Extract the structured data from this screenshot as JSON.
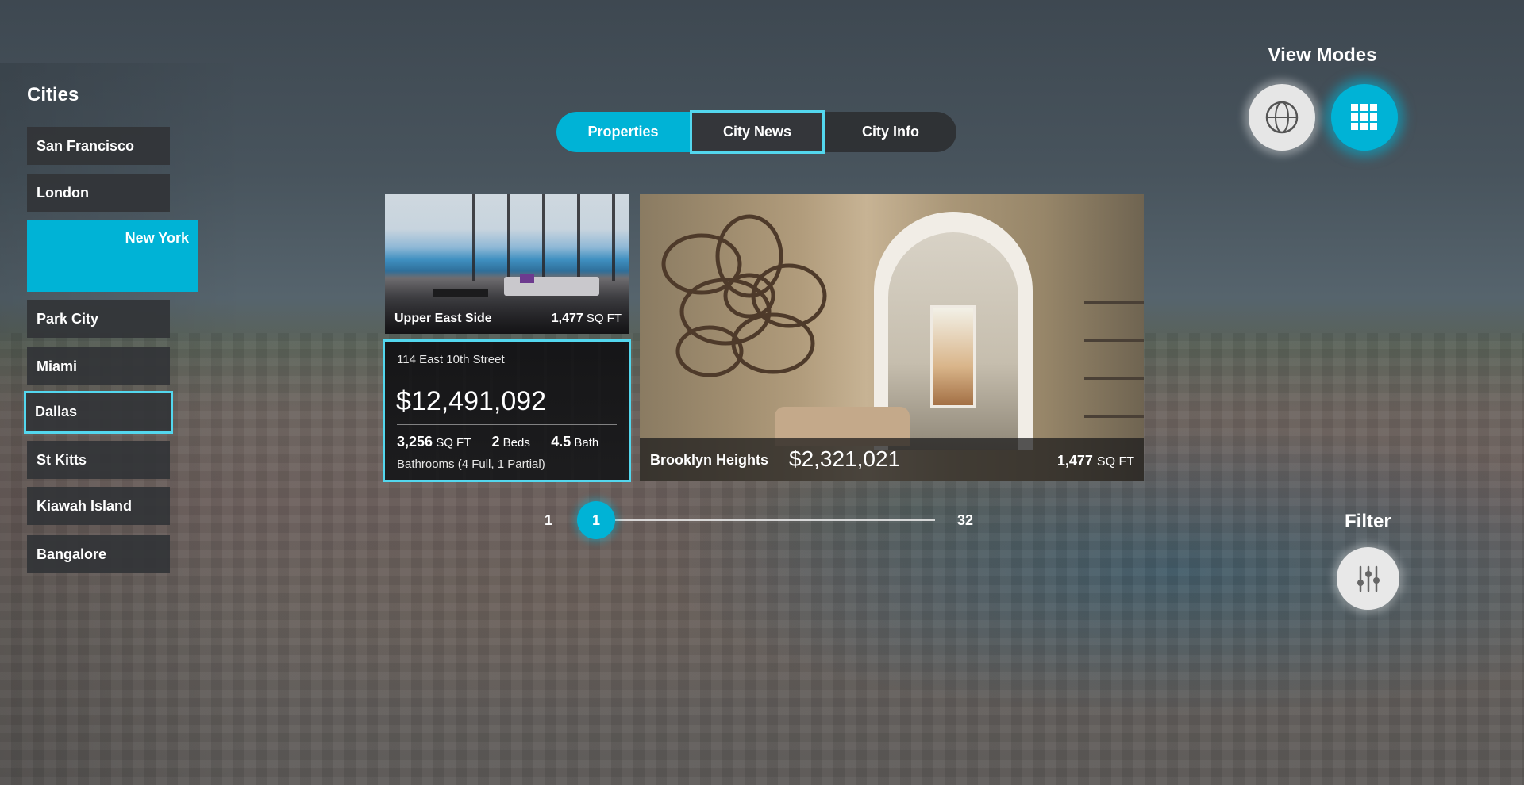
{
  "sidebar": {
    "title": "Cities",
    "items": [
      {
        "label": "San Francisco"
      },
      {
        "label": "London"
      },
      {
        "label": "New York"
      },
      {
        "label": "Park City"
      },
      {
        "label": "Miami"
      },
      {
        "label": "Dallas"
      },
      {
        "label": "St Kitts"
      },
      {
        "label": "Kiawah Island"
      },
      {
        "label": "Bangalore"
      }
    ],
    "active": "New York",
    "focused": "Dallas"
  },
  "tabs": [
    {
      "label": "Properties",
      "state": "active"
    },
    {
      "label": "City News",
      "state": "focused"
    },
    {
      "label": "City Info",
      "state": "normal"
    }
  ],
  "view_modes": {
    "title": "View Modes",
    "modes": [
      {
        "icon": "globe-icon",
        "state": "normal"
      },
      {
        "icon": "grid-icon",
        "state": "active"
      }
    ]
  },
  "listings": {
    "upper_east_side": {
      "name": "Upper East Side",
      "sqft": "1,477",
      "sqft_unit": "SQ FT"
    },
    "detail": {
      "address": "114 East 10th Street",
      "price": "$12,491,092",
      "sqft": "3,256",
      "sqft_unit": "SQ FT",
      "beds": "2",
      "beds_label": "Beds",
      "baths": "4.5",
      "baths_label": "Bath",
      "bathrooms_note": "Bathrooms (4 Full, 1 Partial)"
    },
    "brooklyn": {
      "name": "Brooklyn Heights",
      "price": "$2,321,021",
      "sqft": "1,477",
      "sqft_unit": "SQ FT"
    }
  },
  "pagination": {
    "start": "1",
    "current": "1",
    "total": "32",
    "progress": 0.0
  },
  "filter": {
    "title": "Filter",
    "icon": "sliders-icon"
  },
  "colors": {
    "accent": "#00b3d6",
    "focus_outline": "#53d7ee",
    "tile": "#323437"
  }
}
